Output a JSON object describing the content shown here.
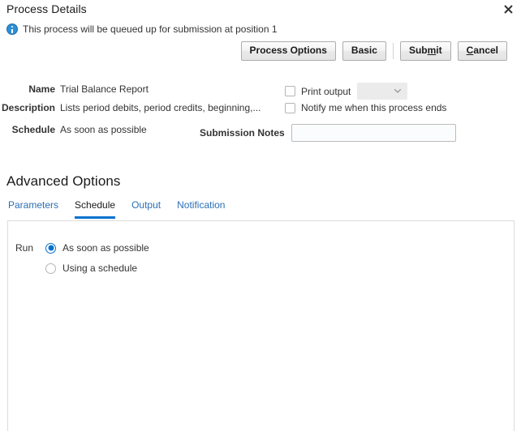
{
  "header": {
    "title": "Process Details",
    "close_icon": "close-icon"
  },
  "message": {
    "icon": "info-icon",
    "text": "This process will be queued up for submission at position 1"
  },
  "toolbar": {
    "buttons": [
      {
        "label": "Process Options",
        "accesskey": ""
      },
      {
        "label": "Basic",
        "accesskey": ""
      },
      {
        "label_before": "Sub",
        "accesskey": "m",
        "label_after": "it"
      },
      {
        "label_before": "",
        "accesskey": "C",
        "label_after": "ancel"
      }
    ],
    "process_options_label": "Process Options",
    "basic_label": "Basic",
    "submit_pre": "Sub",
    "submit_key": "m",
    "submit_post": "it",
    "cancel_key": "C",
    "cancel_post": "ancel"
  },
  "form": {
    "name_label": "Name",
    "name_value": "Trial Balance Report",
    "description_label": "Description",
    "description_value": "Lists period debits, period credits, beginning,...",
    "schedule_label": "Schedule",
    "schedule_value": "As soon as possible",
    "print_output_label": "Print output",
    "print_output_checked": false,
    "print_output_select_value": "",
    "print_output_select_disabled": true,
    "notify_label": "Notify me when this process ends",
    "notify_checked": false,
    "submission_notes_label": "Submission Notes",
    "submission_notes_value": "",
    "submission_notes_placeholder": ""
  },
  "advanced": {
    "title": "Advanced Options",
    "tabs": [
      {
        "label": "Parameters",
        "active": false
      },
      {
        "label": "Schedule",
        "active": true
      },
      {
        "label": "Output",
        "active": false
      },
      {
        "label": "Notification",
        "active": false
      }
    ],
    "run_label": "Run",
    "options": [
      {
        "label": "As soon as possible",
        "selected": true
      },
      {
        "label": "Using a schedule",
        "selected": false
      }
    ]
  },
  "colors": {
    "accent": "#0572ce",
    "link": "#2a6fb5",
    "text": "#333333",
    "border": "#dcdcdc",
    "info": "#2d8fd5"
  }
}
